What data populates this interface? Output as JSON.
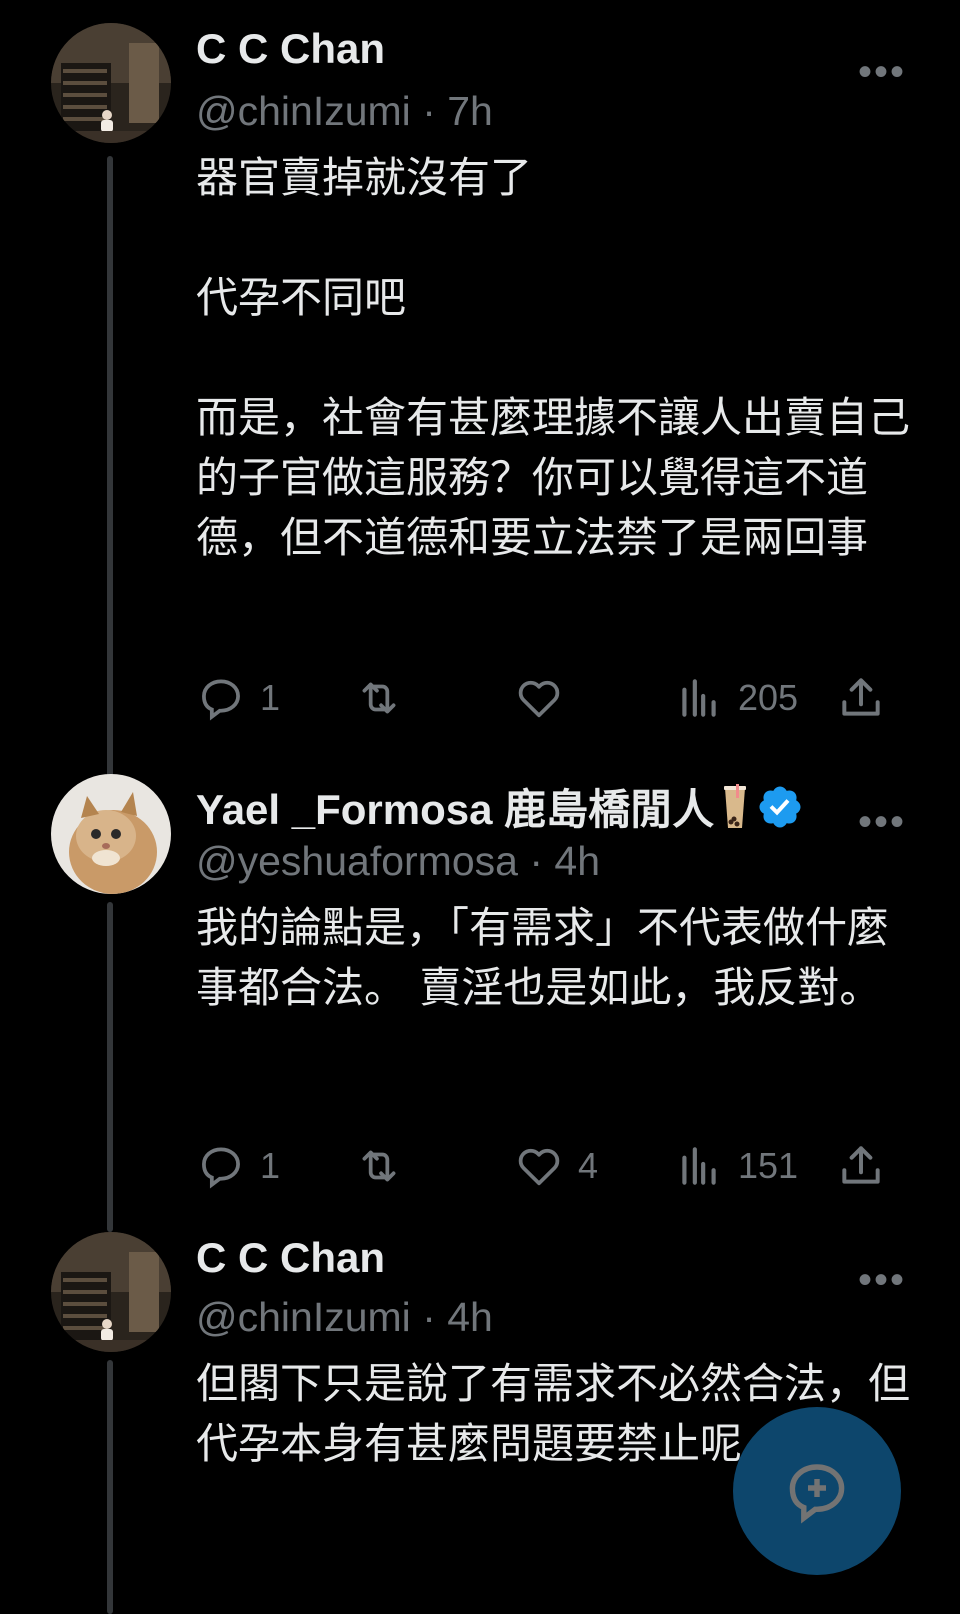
{
  "tweets": [
    {
      "name": "C C Chan",
      "handle": "@chinIzumi",
      "time": "· 7h",
      "paragraphs": [
        "器官賣掉就沒有了",
        "代孕不同吧",
        "而是，社會有甚麼理據不讓人出賣自己的子官做這服務？你可以覺得這不道德，但不道德和要立法禁了是兩回事"
      ],
      "replies": "1",
      "retweets": "",
      "likes": "",
      "views": "205"
    },
    {
      "name": "Yael _Formosa 鹿島橋閒人",
      "handle": "@yeshuaformosa",
      "time": "· 4h",
      "paragraphs": [
        "我的論點是，「有需求」不代表做什麼事都合法。 賣淫也是如此，我反對。"
      ],
      "replies": "1",
      "retweets": "",
      "likes": "4",
      "views": "151"
    },
    {
      "name": "C C Chan",
      "handle": "@chinIzumi",
      "time": "· 4h",
      "paragraphs": [
        "但閣下只是說了有需求不必然合法，但代孕本身有甚麼問題要禁止呢"
      ]
    }
  ],
  "icons": {
    "more": "more-icon",
    "reply": "reply-icon",
    "retweet": "retweet-icon",
    "like": "heart-icon",
    "views": "views-icon",
    "share": "share-icon",
    "verified": "verified-badge-icon",
    "compose": "compose-reply-icon"
  },
  "colors": {
    "background": "#000000",
    "text": "#e7e9ea",
    "secondary": "#71767b",
    "accent": "#1d9bf0",
    "thread_line": "#333639"
  }
}
